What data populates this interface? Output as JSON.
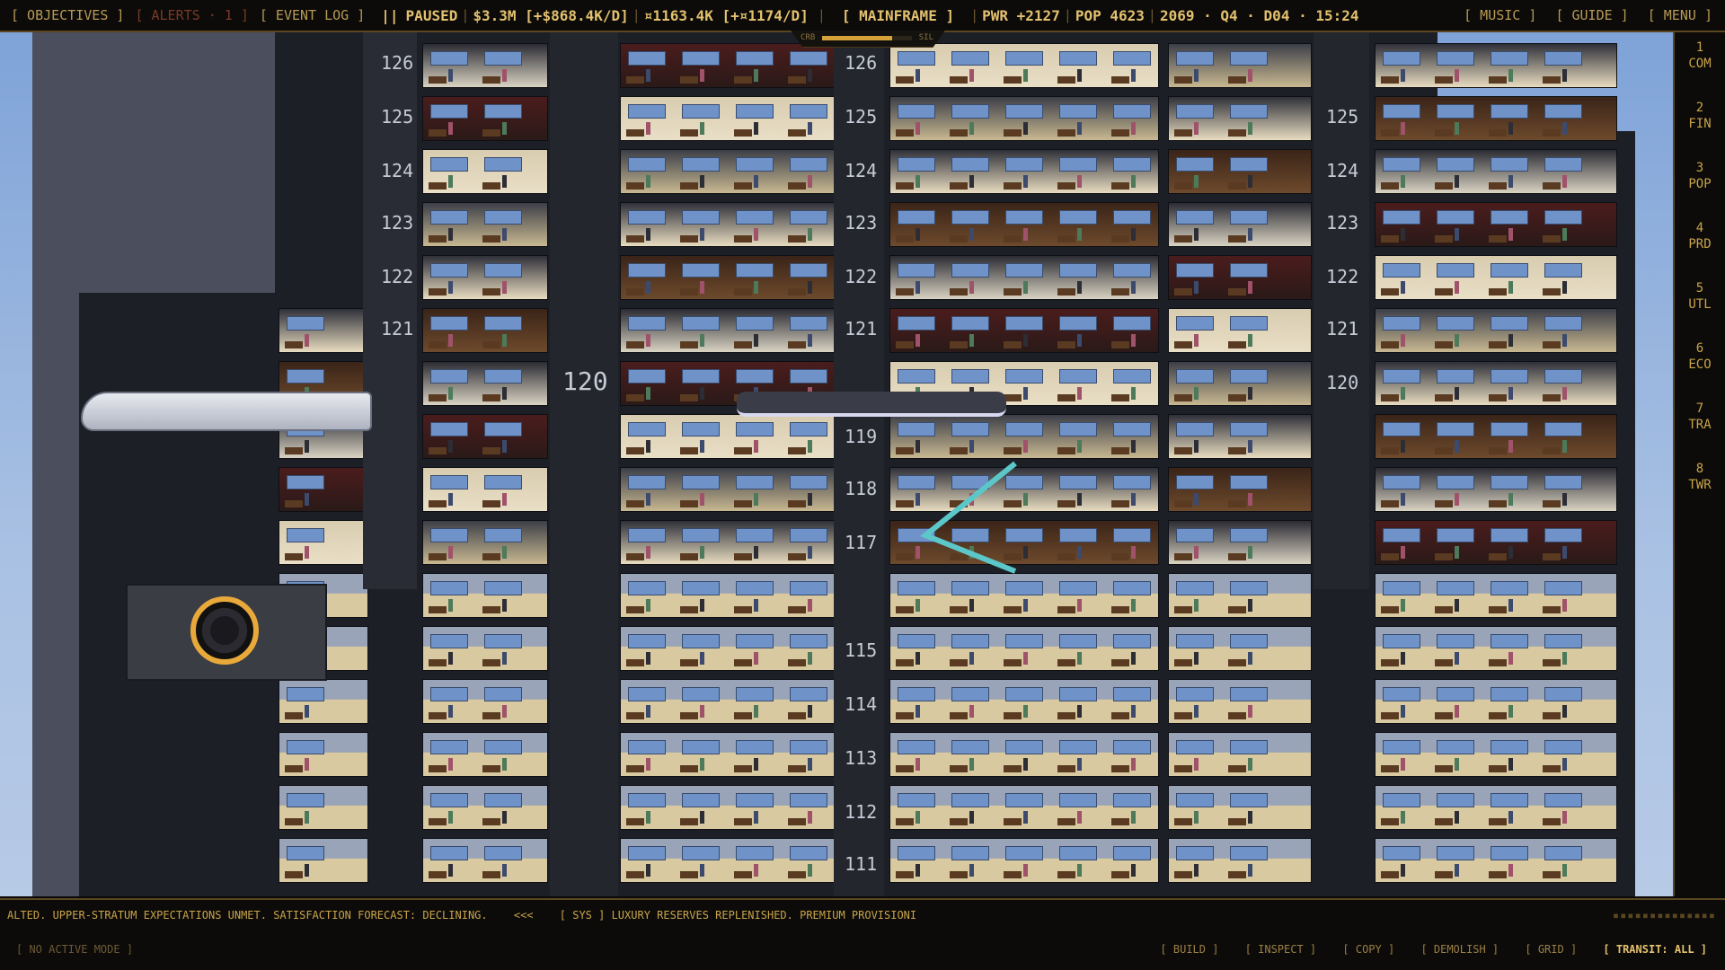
{
  "top_bar": {
    "objectives": "[ OBJECTIVES ]",
    "alerts": "[ ALERTS · 1 ]",
    "event_log": "[ EVENT LOG ]",
    "pause_symbol": "||",
    "status": "PAUSED",
    "money": "$3.3M [+$868.4K/D]",
    "credits": "¤1163.4K [+¤1174/D]",
    "view": "[ MAINFRAME ]",
    "power": "PWR +2127",
    "population": "POP 4623",
    "date": "2069 · Q4 · D04 · 15:24",
    "music": "[ MUSIC ]",
    "guide": "[ GUIDE ]",
    "menu": "[ MENU ]"
  },
  "gauge": {
    "left_label": "CRB",
    "right_label": "SIL",
    "level": 0.78,
    "fill_color": "#d6a23a"
  },
  "sidebar": {
    "items": [
      {
        "num": "1",
        "label": "COM"
      },
      {
        "num": "2",
        "label": "FIN"
      },
      {
        "num": "3",
        "label": "POP"
      },
      {
        "num": "4",
        "label": "PRD"
      },
      {
        "num": "5",
        "label": "UTL"
      },
      {
        "num": "6",
        "label": "ECO"
      },
      {
        "num": "7",
        "label": "TRA"
      },
      {
        "num": "8",
        "label": "TWR"
      }
    ]
  },
  "floors": {
    "f126": "126",
    "f125": "125",
    "f124": "124",
    "f123": "123",
    "f122": "122",
    "f121": "121",
    "f120": "120",
    "f119": "119",
    "f118": "118",
    "f117": "117",
    "f115": "115",
    "f114": "114",
    "f113": "113",
    "f112": "112",
    "f111": "111"
  },
  "ticker": {
    "message1": "ALTED. UPPER-STRATUM EXPECTATIONS UNMET. SATISFACTION FORECAST: DECLINING.",
    "divider": "<<<",
    "message2": "[ SYS ] LUXURY RESERVES REPLENISHED. PREMIUM PROVISIONI"
  },
  "bottom_bar": {
    "mode": "[ NO ACTIVE MODE ]",
    "build": "[ BUILD ]",
    "inspect": "[ INSPECT ]",
    "copy": "[ COPY ]",
    "demolish": "[ DEMOLISH ]",
    "grid": "[ GRID ]",
    "transit": "[ TRANSIT: ALL ]"
  },
  "colors": {
    "accent": "#c9a44a",
    "alert": "#7a3a2a",
    "sky": "#8fb0de"
  },
  "icons": {
    "gauge": "resource-gauge-icon",
    "reactor": "reactor-core-icon",
    "train": "maglev-train-icon"
  }
}
